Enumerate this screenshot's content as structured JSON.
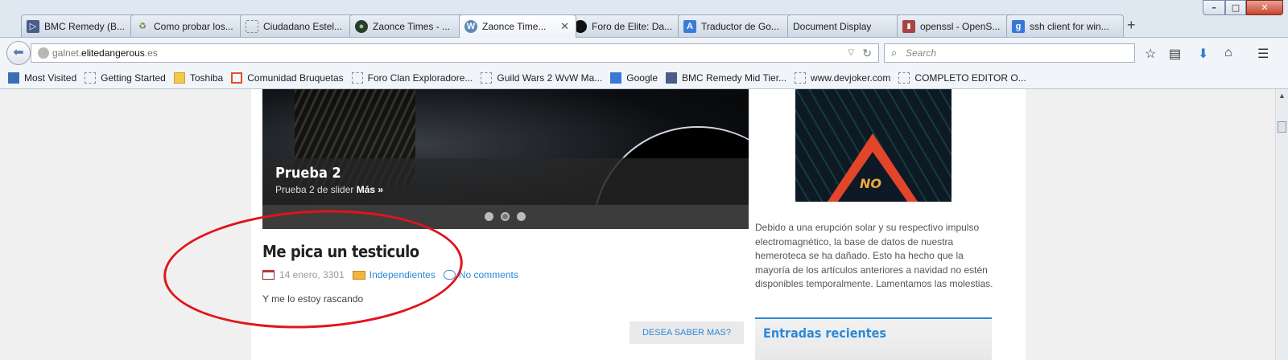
{
  "tabs": [
    {
      "label": "BMC Remedy (B...",
      "icon": "bmc-icon"
    },
    {
      "label": "Como probar los...",
      "icon": "recycle-icon"
    },
    {
      "label": "Ciudadano Estel...",
      "icon": "page-icon"
    },
    {
      "label": "Zaonce Times - ...",
      "icon": "globe-icon"
    },
    {
      "label": "Zaonce Time...",
      "icon": "wordpress-icon"
    },
    {
      "label": "Foro de Elite: Da...",
      "icon": "elite-icon"
    },
    {
      "label": "Traductor de Go...",
      "icon": "translate-icon"
    },
    {
      "label": "Document Display",
      "icon": ""
    },
    {
      "label": "openssl - OpenS...",
      "icon": "openssl-icon"
    },
    {
      "label": "ssh client for win...",
      "icon": "google-icon"
    }
  ],
  "address": {
    "prefix": "galnet.",
    "domain": "elitedangerous",
    "suffix": ".es"
  },
  "search": {
    "placeholder": "Search"
  },
  "bookmarks": [
    {
      "label": "Most Visited"
    },
    {
      "label": "Getting Started"
    },
    {
      "label": "Toshiba"
    },
    {
      "label": "Comunidad Bruquetas"
    },
    {
      "label": "Foro Clan Exploradore..."
    },
    {
      "label": "Guild Wars 2 WvW Ma..."
    },
    {
      "label": "Google"
    },
    {
      "label": "BMC Remedy Mid Tier..."
    },
    {
      "label": "www.devjoker.com"
    },
    {
      "label": "COMPLETO EDITOR O..."
    }
  ],
  "slider": {
    "title": "Prueba 2",
    "subtitle": "Prueba 2 de slider",
    "more": "Más »"
  },
  "post": {
    "title": "Me pica un testiculo",
    "date": "14 enero, 3301",
    "category": "Independientes",
    "comments": "No comments",
    "excerpt": "Y me lo estoy rascando",
    "more_button": "DESEA SABER MAS?"
  },
  "sidebar": {
    "image_text": "NO",
    "notice": "Debido a una erupción solar y su respectivo impulso electromagnético, la base de datos de nuestra hemeroteca se ha dañado. Esto ha hecho que la mayoría de los artículos anteriores a navidad no estén disponibles temporalmente. Lamentamos las molestias.",
    "recent_heading": "Entradas recientes"
  },
  "colors": {
    "accent": "#2a8ad8",
    "annotation": "#e0141d"
  }
}
